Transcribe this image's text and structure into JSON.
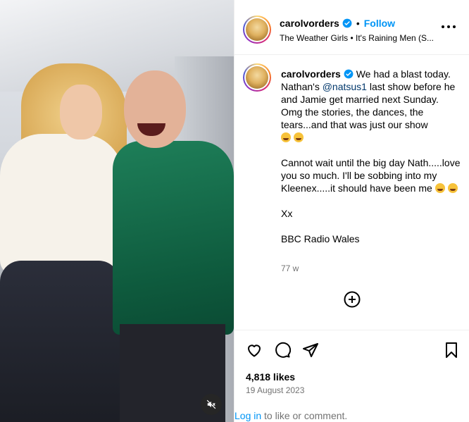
{
  "post": {
    "username": "carolvorders",
    "follow_label": "Follow",
    "separator": "•",
    "audio": "The Weather Girls • It's Raining Men (S...",
    "caption": {
      "username": "carolvorders",
      "p1_a": "We had a blast today. Nathan's",
      "mention": "@natsus1",
      "p1_b": "last show before he and Jamie get married next Sunday. Omg the stories, the dances, the tears...and that was just our show",
      "p2": "Cannot wait until the big day Nath.....love you so much. I'll be sobbing into my Kleenex.....it should have been me",
      "p3": "Xx",
      "p4": "BBC Radio Wales",
      "time": "77 w"
    },
    "likes": "4,818 likes",
    "date": "19 August 2023",
    "login_link": "Log in",
    "login_rest": "to like or comment."
  },
  "icons": [
    "verified-badge-icon",
    "more-options-icon",
    "add-comment-icon",
    "heart-icon",
    "comment-icon",
    "share-icon",
    "bookmark-icon",
    "mute-icon"
  ],
  "colors": {
    "accent": "#0095f6",
    "mention": "#00376b",
    "muted": "#737373",
    "border": "#efefef"
  }
}
